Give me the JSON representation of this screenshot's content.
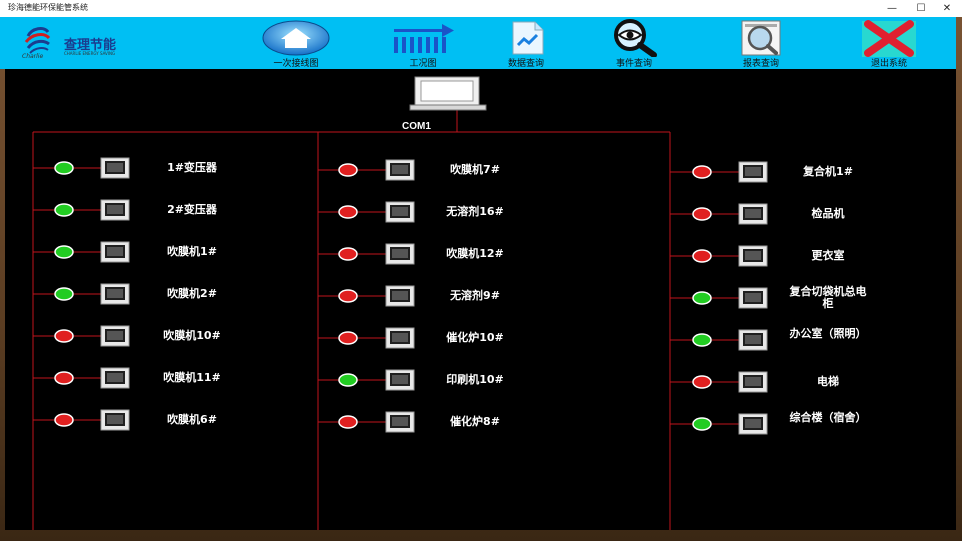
{
  "window": {
    "title": "珍海德能环保能管系统",
    "minimize": "—",
    "maximize": "☐",
    "close": "✕"
  },
  "toolbar": {
    "logo_text": "查理节能",
    "logo_sub": "CHARLIE ENERGY SAVING",
    "logo_brand": "Charlie",
    "items": [
      {
        "label": "一次接线图",
        "icon": "house-icon"
      },
      {
        "label": "工况图",
        "icon": "arrow-right-icon"
      },
      {
        "label": "数据查询",
        "icon": "data-file-icon"
      },
      {
        "label": "事件查询",
        "icon": "magnifier-eye-icon"
      },
      {
        "label": "报表查询",
        "icon": "report-search-icon"
      },
      {
        "label": "退出系统",
        "icon": "exit-x-icon"
      }
    ]
  },
  "bus": {
    "label": "COM1"
  },
  "colors": {
    "on": "#22cc22",
    "off": "#e02020",
    "line": "#c0141c"
  },
  "columns": [
    {
      "devices": [
        {
          "name": "1#变压器",
          "status": "on"
        },
        {
          "name": "2#变压器",
          "status": "on"
        },
        {
          "name": "吹膜机1#",
          "status": "on"
        },
        {
          "name": "吹膜机2#",
          "status": "on"
        },
        {
          "name": "吹膜机10#",
          "status": "off"
        },
        {
          "name": "吹膜机11#",
          "status": "off"
        },
        {
          "name": "吹膜机6#",
          "status": "off"
        }
      ]
    },
    {
      "devices": [
        {
          "name": "吹膜机7#",
          "status": "off"
        },
        {
          "name": "无溶剂16#",
          "status": "off"
        },
        {
          "name": "吹膜机12#",
          "status": "off"
        },
        {
          "name": "无溶剂9#",
          "status": "off"
        },
        {
          "name": "催化炉10#",
          "status": "off"
        },
        {
          "name": "印刷机10#",
          "status": "on"
        },
        {
          "name": "催化炉8#",
          "status": "off"
        }
      ]
    },
    {
      "devices": [
        {
          "name": "复合机1#",
          "status": "off"
        },
        {
          "name": "检品机",
          "status": "off"
        },
        {
          "name": "更衣室",
          "status": "off"
        },
        {
          "name": "复合切袋机总电柜",
          "status": "on"
        },
        {
          "name": "办公室（照明）",
          "status": "on"
        },
        {
          "name": "电梯",
          "status": "off"
        },
        {
          "name": "综合楼（宿舍）",
          "status": "on"
        }
      ]
    }
  ]
}
